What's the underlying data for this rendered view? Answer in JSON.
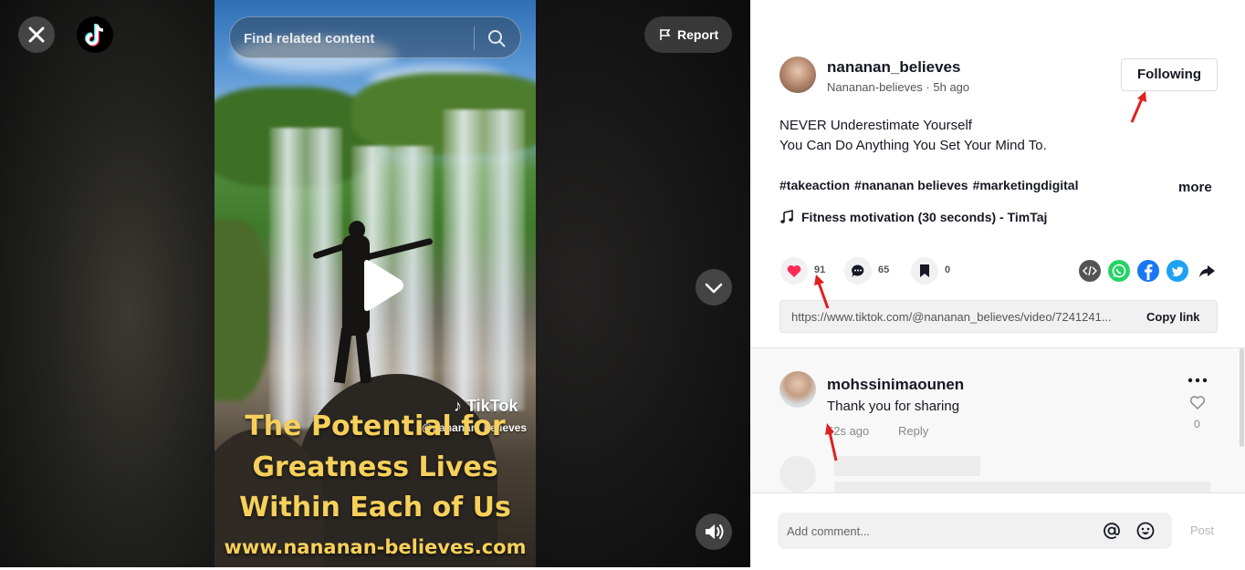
{
  "video": {
    "search_placeholder": "Find related content",
    "report_label": "Report",
    "overlay_caption": [
      "The Potential for",
      "Greatness Lives",
      "Within Each of Us"
    ],
    "overlay_url": "www.nananan-believes.com",
    "watermark_brand": "TikTok",
    "watermark_user": "@nananan_believes"
  },
  "post": {
    "username": "nananan_believes",
    "display_name": "Nananan-believes",
    "time_ago": "5h ago",
    "follow_label": "Following",
    "description": [
      "NEVER Underestimate Yourself",
      "You Can Do Anything You Set Your Mind To."
    ],
    "hashtags": [
      "#takeaction",
      "#nananan believes",
      "#marketingdigital"
    ],
    "more_label": "more",
    "music": "Fitness motivation (30 seconds) - TimTaj",
    "likes": "91",
    "comments": "65",
    "saves": "0",
    "link_url": "https://www.tiktok.com/@nananan_believes/video/7241241...",
    "copy_link_label": "Copy link"
  },
  "comment": {
    "username": "mohssinimaounen",
    "text": "Thank you for sharing",
    "time": "52s ago",
    "reply_label": "Reply",
    "likes": "0"
  },
  "composer": {
    "placeholder": "Add comment...",
    "post_label": "Post"
  },
  "colors": {
    "like_red": "#fe2c55",
    "whatsapp": "#25d366",
    "facebook": "#1877f2",
    "twitter": "#1da1f2",
    "embed": "#545454",
    "caption_yellow": "#f6d05a",
    "annotation_red": "#e02020"
  },
  "icons": [
    "close-icon",
    "tiktok-logo",
    "search-icon",
    "flag-icon",
    "play-icon",
    "chevron-down-icon",
    "volume-icon",
    "music-note-icon",
    "heart-icon",
    "comment-icon",
    "bookmark-icon",
    "embed-icon",
    "whatsapp-icon",
    "facebook-icon",
    "twitter-icon",
    "share-arrow-icon",
    "more-dots-icon",
    "heart-outline-icon",
    "mention-icon",
    "emoji-icon"
  ]
}
